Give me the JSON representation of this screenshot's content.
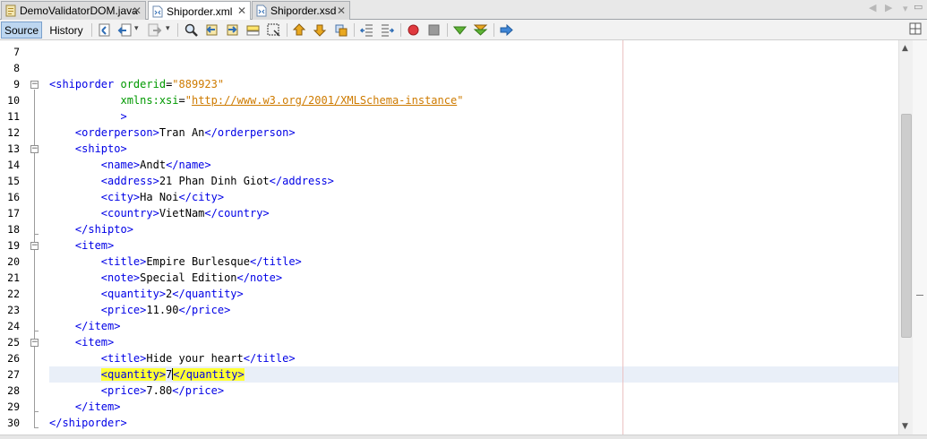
{
  "tabs": [
    {
      "label": "DemoValidatorDOM.java",
      "active": false
    },
    {
      "label": "Shiporder.xml",
      "active": true
    },
    {
      "label": "Shiporder.xsd",
      "active": false
    }
  ],
  "toolbar": {
    "source_label": "Source",
    "history_label": "History"
  },
  "editor": {
    "line_numbers": [
      "7",
      "8",
      "9",
      "10",
      "11",
      "12",
      "13",
      "14",
      "15",
      "16",
      "17",
      "18",
      "19",
      "20",
      "21",
      "22",
      "23",
      "24",
      "25",
      "26",
      "27",
      "28",
      "29",
      "30"
    ],
    "code": {
      "l9_open": "<shiporder",
      "l9_attr": "orderid",
      "l9_val": "\"889923\"",
      "l10_attr": "xmlns:xsi",
      "l10_val_q1": "\"",
      "l10_val_url": "http://www.w3.org/2001/XMLSchema-instance",
      "l10_val_q2": "\"",
      "l11_close": ">",
      "l12_open": "<orderperson>",
      "l12_text": "Tran An",
      "l12_close": "</orderperson>",
      "l13_open": "<shipto>",
      "l14_open": "<name>",
      "l14_text": "Andt",
      "l14_close": "</name>",
      "l15_open": "<address>",
      "l15_text": "21 Phan Dinh Giot",
      "l15_close": "</address>",
      "l16_open": "<city>",
      "l16_text": "Ha Noi",
      "l16_close": "</city>",
      "l17_open": "<country>",
      "l17_text": "VietNam",
      "l17_close": "</country>",
      "l18_close": "</shipto>",
      "l19_open": "<item>",
      "l20_open": "<title>",
      "l20_text": "Empire Burlesque",
      "l20_close": "</title>",
      "l21_open": "<note>",
      "l21_text": "Special Edition",
      "l21_close": "</note>",
      "l22_open": "<quantity>",
      "l22_text": "2",
      "l22_close": "</quantity>",
      "l23_open": "<price>",
      "l23_text": "11.90",
      "l23_close": "</price>",
      "l24_close": "</item>",
      "l25_open": "<item>",
      "l26_open": "<title>",
      "l26_text": "Hide your heart",
      "l26_close": "</title>",
      "l27_open": "<quantity>",
      "l27_text": "7",
      "l27_close": "</quantity>",
      "l28_open": "<price>",
      "l28_text": "7.80",
      "l28_close": "</price>",
      "l29_close": "</item>",
      "l30_close": "</shiporder>"
    }
  },
  "colors": {
    "tag": "#0000e6",
    "attribute": "#009900",
    "value": "#ce7b00",
    "current_line": "#e9eff8",
    "match_highlight": "#ffff33"
  }
}
